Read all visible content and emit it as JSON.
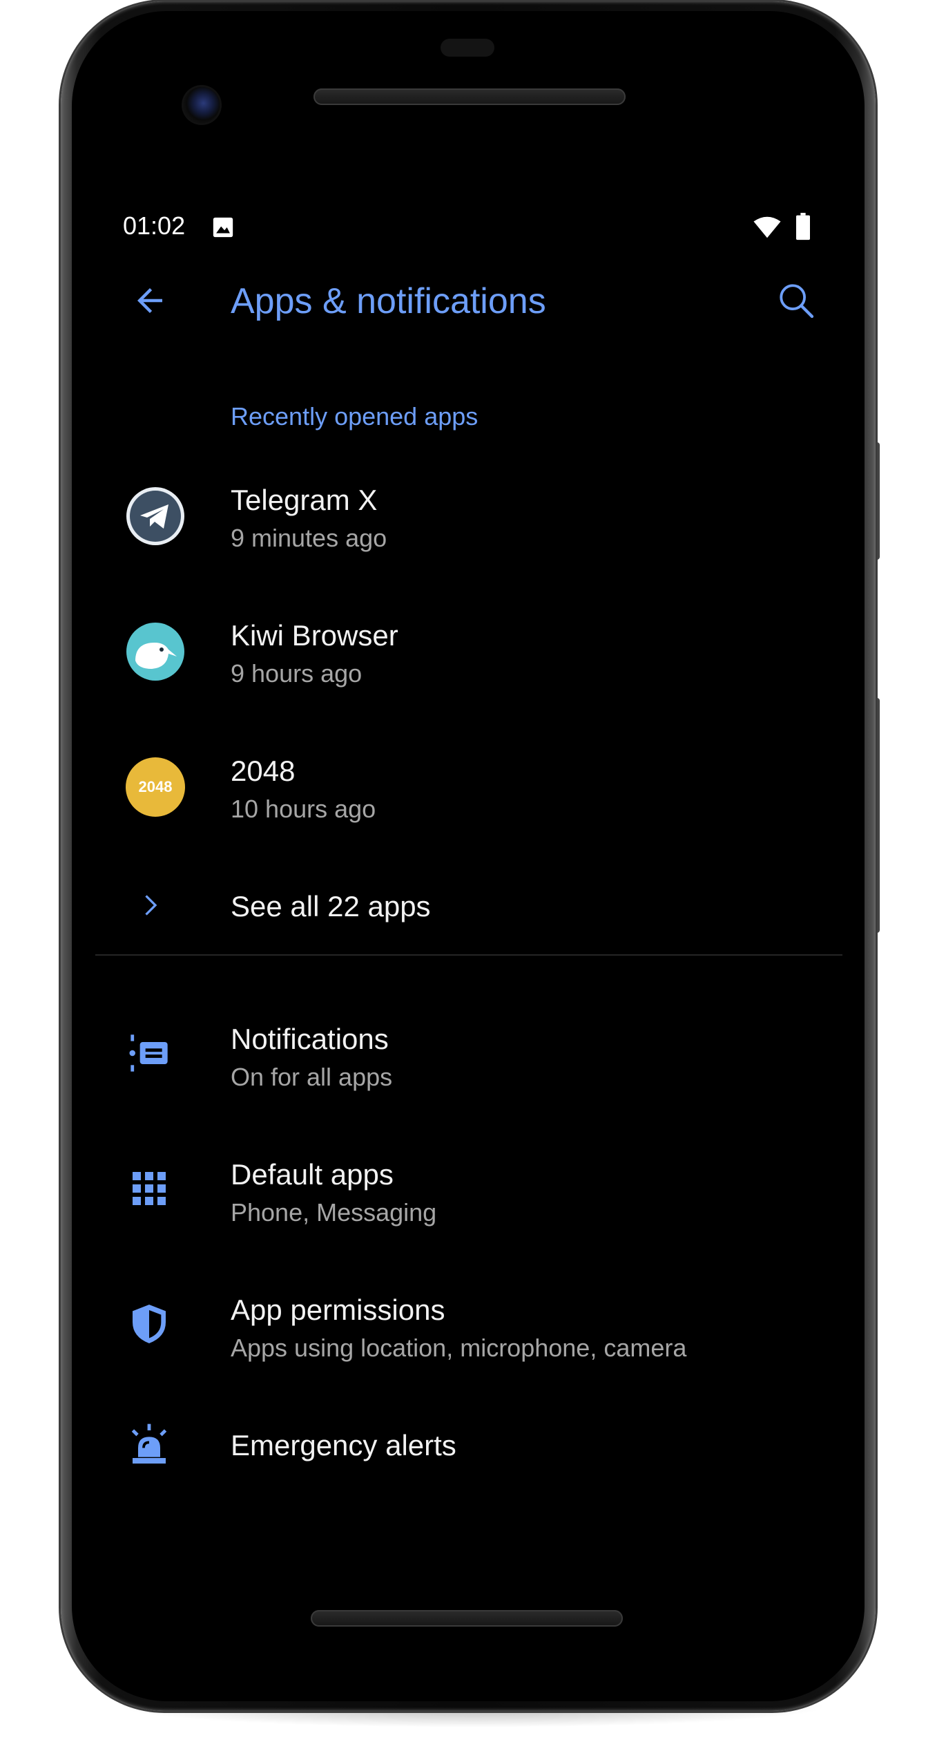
{
  "status_bar": {
    "time": "01:02",
    "left_icons": [
      "image-icon"
    ],
    "right_icons": [
      "wifi-icon",
      "battery-icon"
    ]
  },
  "app_bar": {
    "title": "Apps & notifications",
    "back_icon": "arrow-back-icon",
    "search_icon": "search-icon"
  },
  "recent": {
    "header": "Recently opened apps",
    "apps": [
      {
        "name": "Telegram X",
        "time": "9 minutes ago",
        "icon": "telegram-x-icon"
      },
      {
        "name": "Kiwi Browser",
        "time": "9 hours ago",
        "icon": "kiwi-browser-icon"
      },
      {
        "name": "2048",
        "time": "10 hours ago",
        "icon": "2048-icon",
        "icon_text": "2048"
      }
    ],
    "see_all": "See all 22 apps"
  },
  "settings": [
    {
      "title": "Notifications",
      "summary": "On for all apps",
      "icon": "notifications-icon"
    },
    {
      "title": "Default apps",
      "summary": "Phone, Messaging",
      "icon": "apps-grid-icon"
    },
    {
      "title": "App permissions",
      "summary": "Apps using location, microphone, camera",
      "icon": "shield-icon"
    },
    {
      "title": "Emergency alerts",
      "icon": "siren-icon"
    }
  ],
  "colors": {
    "accent": "#6d9ef8",
    "background": "#000000",
    "title_text": "#f2f2f2",
    "summary_text": "#a6a6a6",
    "app_2048": "#e8b93a"
  }
}
